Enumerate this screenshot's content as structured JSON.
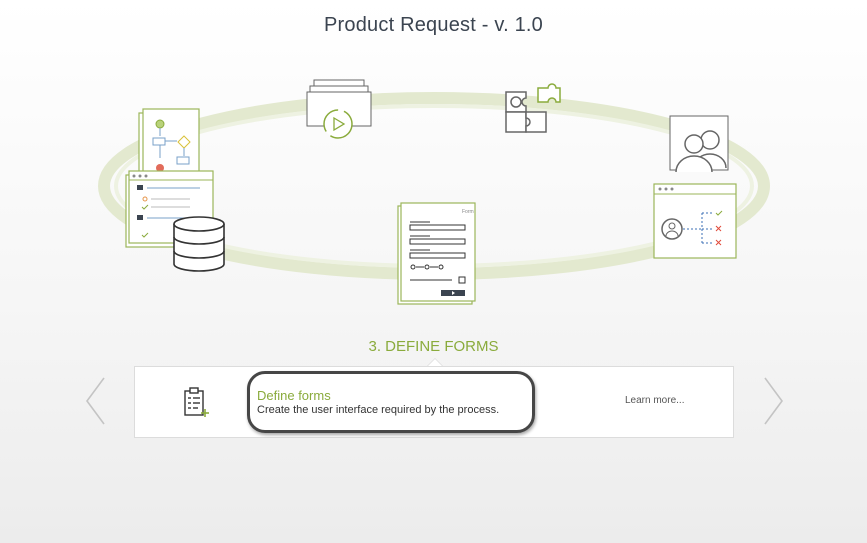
{
  "header": {
    "title": "Product Request - v. 1.0"
  },
  "diagram": {
    "icons": [
      "process-flow-icon",
      "database-icon",
      "form-icon",
      "video-lifecycle-icon",
      "puzzle-icon",
      "users-icon",
      "decision-list-icon"
    ],
    "form_thumbnail_label": "Form"
  },
  "step": {
    "label": "3. DEFINE FORMS",
    "title": "Define forms",
    "description": "Create the user interface required by the process.",
    "link": "Learn more..."
  },
  "nav": {
    "prev_icon": "chevron-left-icon",
    "next_icon": "chevron-right-icon"
  },
  "colors": {
    "accent": "#8aab3c",
    "ring": "#dfe6c9",
    "text": "#3b4450"
  }
}
